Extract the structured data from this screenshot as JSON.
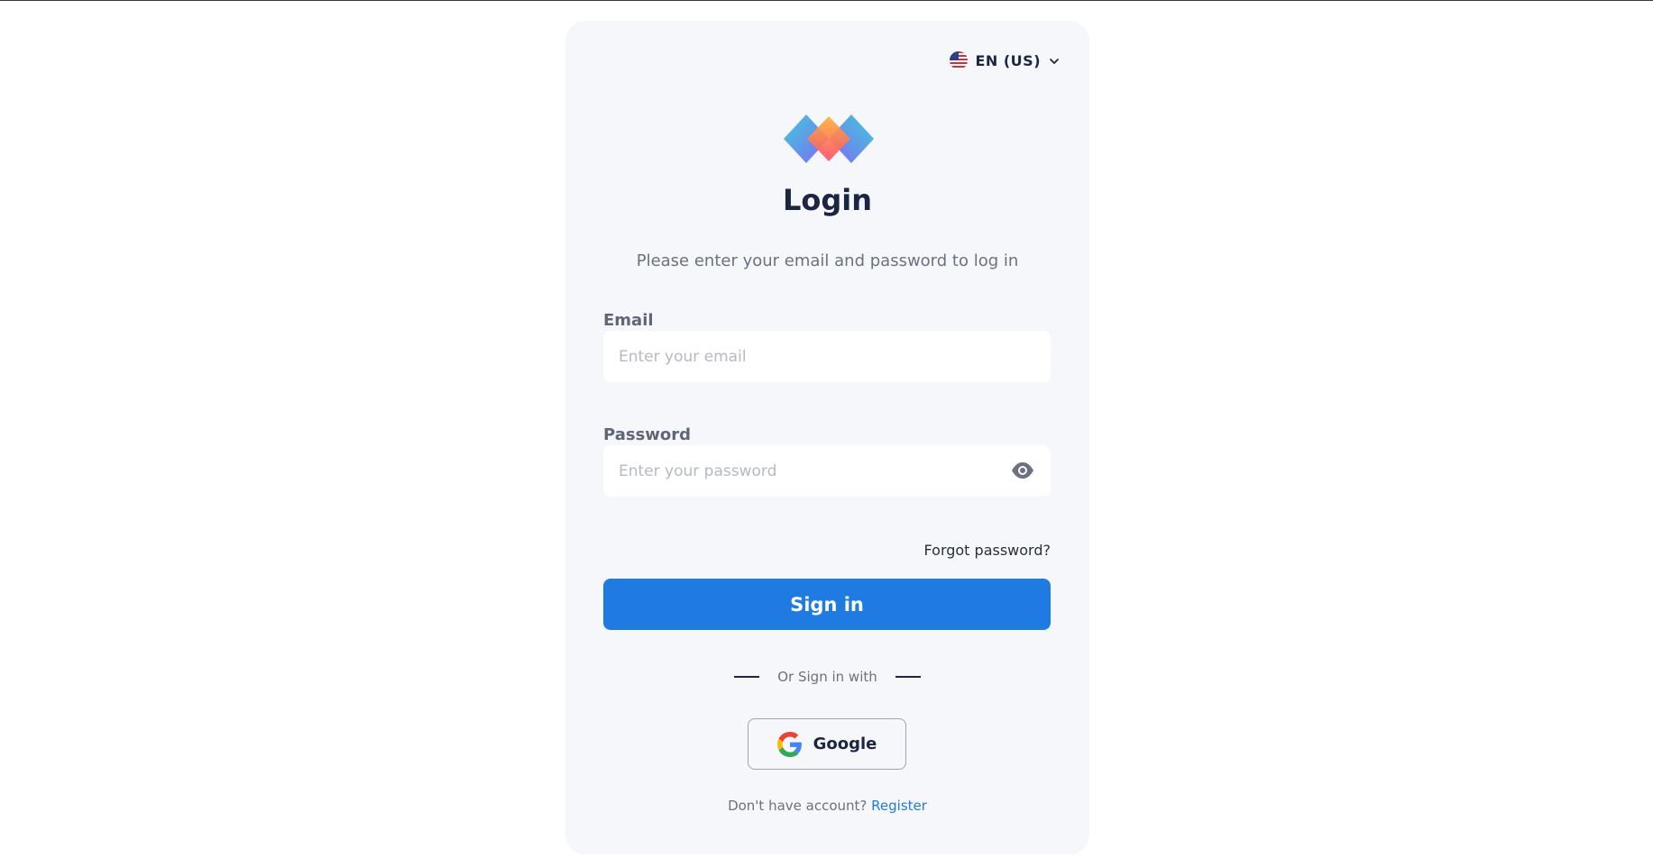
{
  "language": {
    "label": "EN (US)",
    "flag_icon": "us-flag-icon",
    "chevron_icon": "chevron-down-icon"
  },
  "logo": {
    "icon": "brand-diamonds-logo",
    "colors": [
      "#35c9dc",
      "#7a62f2",
      "#ff8c3a",
      "#ff4f6a"
    ]
  },
  "login": {
    "title": "Login",
    "subtitle": "Please enter your email and password to log in"
  },
  "email": {
    "label": "Email",
    "placeholder": "Enter your email",
    "value": ""
  },
  "password": {
    "label": "Password",
    "placeholder": "Enter your password",
    "value": "",
    "toggle_icon": "eye-icon"
  },
  "forgot_password": "Forgot password?",
  "sign_in": {
    "label": "Sign in",
    "color": "#1f7be1"
  },
  "divider": {
    "text": "Or Sign in with"
  },
  "google": {
    "label": "Google",
    "icon": "google-g-icon"
  },
  "register": {
    "prompt": "Don't have account?",
    "link": "Register"
  }
}
